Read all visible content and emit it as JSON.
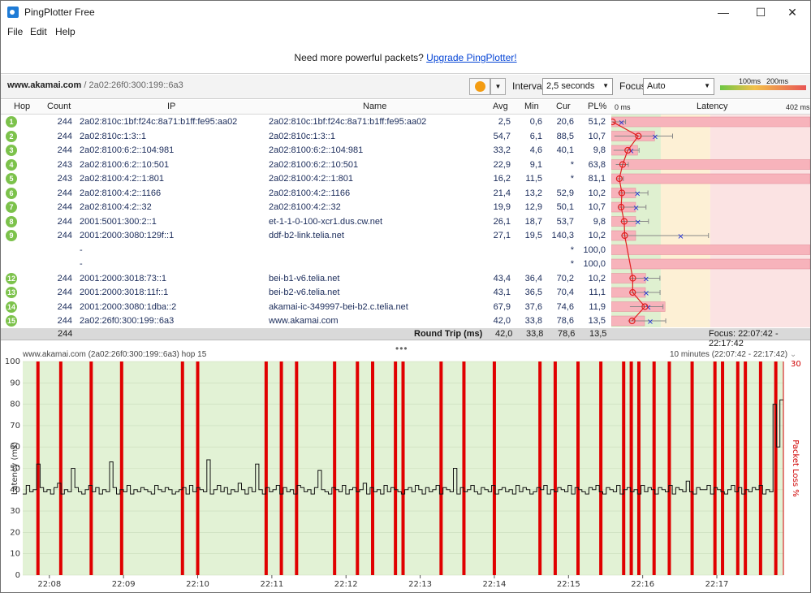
{
  "window": {
    "title": "PingPlotter Free",
    "controls": [
      "—",
      "☐",
      "✕"
    ]
  },
  "menu": [
    "File",
    "Edit",
    "Help"
  ],
  "banner": {
    "text": "Need more powerful packets?",
    "link": "Upgrade PingPlotter!"
  },
  "toolbar": {
    "target_host": "www.akamai.com",
    "target_sep": " / ",
    "target_ip": "2a02:26f0:300:199::6a3",
    "interval_label": "Interval",
    "interval_value": "2,5 seconds",
    "focus_label": "Focus",
    "focus_value": "Auto",
    "scale_100": "100ms",
    "scale_200": "200ms",
    "colors": {
      "good": "#6cc644",
      "warn": "#f3c14b",
      "bad": "#e85555"
    }
  },
  "table": {
    "headers": {
      "hop": "Hop",
      "count": "Count",
      "ip": "IP",
      "name": "Name",
      "avg": "Avg",
      "min": "Min",
      "cur": "Cur",
      "pl": "PL%",
      "latency": "Latency",
      "lat_min": "0 ms",
      "lat_max": "402 ms"
    },
    "rows": [
      {
        "hop": "1",
        "count": "244",
        "ip": "2a02:810c:1bf:f24c:8a71:b1ff:fe95:aa02",
        "name": "2a02:810c:1bf:f24c:8a71:b1ff:fe95:aa02",
        "avg": "2,5",
        "min": "0,6",
        "cur": "20,6",
        "pl": "51,2"
      },
      {
        "hop": "2",
        "count": "244",
        "ip": "2a02:810c:1:3::1",
        "name": "2a02:810c:1:3::1",
        "avg": "54,7",
        "min": "6,1",
        "cur": "88,5",
        "pl": "10,7"
      },
      {
        "hop": "3",
        "count": "244",
        "ip": "2a02:8100:6:2::104:981",
        "name": "2a02:8100:6:2::104:981",
        "avg": "33,2",
        "min": "4,6",
        "cur": "40,1",
        "pl": "9,8"
      },
      {
        "hop": "4",
        "count": "243",
        "ip": "2a02:8100:6:2::10:501",
        "name": "2a02:8100:6:2::10:501",
        "avg": "22,9",
        "min": "9,1",
        "cur": "*",
        "pl": "63,8"
      },
      {
        "hop": "5",
        "count": "243",
        "ip": "2a02:8100:4:2::1:801",
        "name": "2a02:8100:4:2::1:801",
        "avg": "16,2",
        "min": "11,5",
        "cur": "*",
        "pl": "81,1"
      },
      {
        "hop": "6",
        "count": "244",
        "ip": "2a02:8100:4:2::1166",
        "name": "2a02:8100:4:2::1166",
        "avg": "21,4",
        "min": "13,2",
        "cur": "52,9",
        "pl": "10,2"
      },
      {
        "hop": "7",
        "count": "244",
        "ip": "2a02:8100:4:2::32",
        "name": "2a02:8100:4:2::32",
        "avg": "19,9",
        "min": "12,9",
        "cur": "50,1",
        "pl": "10,7"
      },
      {
        "hop": "8",
        "count": "244",
        "ip": "2001:5001:300:2::1",
        "name": "et-1-1-0-100-xcr1.dus.cw.net",
        "avg": "26,1",
        "min": "18,7",
        "cur": "53,7",
        "pl": "9,8"
      },
      {
        "hop": "9",
        "count": "244",
        "ip": "2001:2000:3080:129f::1",
        "name": "ddf-b2-link.telia.net",
        "avg": "27,1",
        "min": "19,5",
        "cur": "140,3",
        "pl": "10,2"
      },
      {
        "hop": "",
        "count": "",
        "ip": "-",
        "name": "",
        "avg": "",
        "min": "",
        "cur": "*",
        "pl": "100,0"
      },
      {
        "hop": "",
        "count": "",
        "ip": "-",
        "name": "",
        "avg": "",
        "min": "",
        "cur": "*",
        "pl": "100,0"
      },
      {
        "hop": "12",
        "count": "244",
        "ip": "2001:2000:3018:73::1",
        "name": "bei-b1-v6.telia.net",
        "avg": "43,4",
        "min": "36,4",
        "cur": "70,2",
        "pl": "10,2"
      },
      {
        "hop": "13",
        "count": "244",
        "ip": "2001:2000:3018:11f::1",
        "name": "bei-b2-v6.telia.net",
        "avg": "43,1",
        "min": "36,5",
        "cur": "70,4",
        "pl": "11,1"
      },
      {
        "hop": "14",
        "count": "244",
        "ip": "2001:2000:3080:1dba::2",
        "name": "akamai-ic-349997-bei-b2.c.telia.net",
        "avg": "67,9",
        "min": "37,6",
        "cur": "74,6",
        "pl": "11,9"
      },
      {
        "hop": "15",
        "count": "244",
        "ip": "2a02:26f0:300:199::6a3",
        "name": "www.akamai.com",
        "avg": "42,0",
        "min": "33,8",
        "cur": "78,6",
        "pl": "13,5"
      }
    ],
    "summary": {
      "count": "244",
      "label": "Round Trip (ms)",
      "avg": "42,0",
      "min": "33,8",
      "cur": "78,6",
      "pl": "13,5",
      "focus": "Focus: 22:07:42 - 22:17:42"
    }
  },
  "chart_data": {
    "type": "line",
    "title": "www.akamai.com (2a02:26f0:300:199::6a3) hop 15",
    "range_label": "10 minutes (22:07:42 - 22:17:42)",
    "ylabel": "Latency (ms)",
    "ylabel_right": "Packet Loss %",
    "ylim": [
      0,
      100
    ],
    "y_ticks": [
      "0",
      "10",
      "20",
      "30",
      "40",
      "50",
      "60",
      "70",
      "80",
      "90",
      "100"
    ],
    "y2_tick": "30",
    "x_ticks": [
      "22:08",
      "22:09",
      "22:10",
      "22:11",
      "22:12",
      "22:13",
      "22:14",
      "22:15",
      "22:16",
      "22:17"
    ],
    "loss_color": "#e00000",
    "latency_samples": [
      38,
      42,
      39,
      40,
      52,
      41,
      39,
      40,
      38,
      41,
      43,
      38,
      40,
      39,
      50,
      41,
      39,
      38,
      40,
      42,
      39,
      41,
      38,
      40,
      39,
      53,
      41,
      38,
      40,
      39,
      42,
      38,
      40,
      39,
      41,
      40,
      39,
      38,
      42,
      40,
      39,
      41,
      40,
      38,
      39,
      40,
      41,
      38,
      42,
      39,
      41,
      40,
      39,
      54,
      38,
      40,
      42,
      39,
      41,
      38,
      40,
      39,
      43,
      40,
      38,
      41,
      39,
      52,
      40,
      38,
      41,
      39,
      40,
      42,
      38,
      41,
      39,
      40,
      38,
      42,
      41,
      39,
      40,
      38,
      41,
      49,
      40,
      39,
      38,
      41,
      40,
      39,
      42,
      38,
      40,
      41,
      39,
      40,
      43,
      38,
      41,
      39,
      40,
      38,
      42,
      39,
      41,
      40,
      39,
      38,
      40,
      41,
      39,
      42,
      40,
      38,
      41,
      39,
      40,
      42,
      38,
      41,
      40,
      39,
      50,
      38,
      41,
      39,
      40,
      42,
      39,
      38,
      41,
      40,
      39,
      42,
      38,
      40,
      41,
      39,
      40,
      38,
      42,
      39,
      41,
      40,
      38,
      39,
      41,
      40,
      42,
      38,
      40,
      39,
      41,
      40,
      39,
      42,
      38,
      41,
      40,
      39,
      38,
      41,
      40,
      42,
      39,
      38,
      41,
      40,
      39,
      42,
      38,
      40,
      41,
      39,
      40,
      38,
      42,
      39,
      41,
      40,
      38,
      41,
      40,
      39,
      42,
      38,
      41,
      40,
      39,
      44,
      39,
      38,
      41,
      40,
      40,
      42,
      38,
      41,
      40,
      39,
      38,
      40,
      42,
      39,
      41,
      38,
      40,
      39,
      41,
      40,
      42,
      38,
      40,
      39,
      80,
      60,
      82
    ],
    "loss_markers": [
      0.02,
      0.05,
      0.09,
      0.13,
      0.21,
      0.23,
      0.32,
      0.34,
      0.36,
      0.41,
      0.44,
      0.46,
      0.49,
      0.5,
      0.55,
      0.58,
      0.62,
      0.68,
      0.7,
      0.73,
      0.76,
      0.79,
      0.8,
      0.81,
      0.83,
      0.85,
      0.88,
      0.91,
      0.92,
      0.94,
      0.95,
      0.97,
      0.99
    ]
  }
}
